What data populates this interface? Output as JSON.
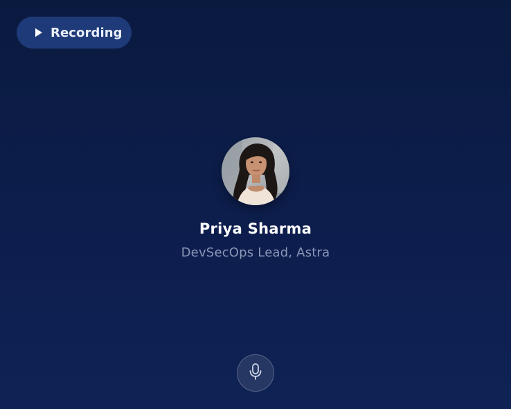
{
  "recording_button": {
    "label": "Recording",
    "icon": "play-icon"
  },
  "profile": {
    "name": "Priya Sharma",
    "title": "DevSecOps Lead, Astra",
    "avatar_icon": "avatar-photo"
  },
  "mic_button": {
    "icon": "microphone-icon"
  },
  "colors": {
    "background_top": "#0a1a3f",
    "background_bottom": "#0f2255",
    "recording_button_bg": "#1e3a78",
    "subtitle": "#8a97b8"
  }
}
